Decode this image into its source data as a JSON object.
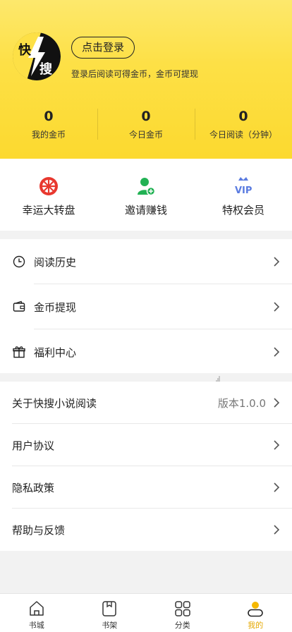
{
  "header": {
    "logo_text": [
      "快",
      "搜"
    ],
    "login_button": "点击登录",
    "login_tip": "登录后阅读可得金币，金币可提现",
    "stats": [
      {
        "value": "0",
        "label": "我的金币"
      },
      {
        "value": "0",
        "label": "今日金币"
      },
      {
        "value": "0",
        "label": "今日阅读（分钟）"
      }
    ]
  },
  "features": [
    {
      "label": "幸运大转盘",
      "icon": "wheel-icon",
      "color": "#e8382f"
    },
    {
      "label": "邀请赚钱",
      "icon": "invite-user-icon",
      "color": "#22b254"
    },
    {
      "label": "特权会员",
      "icon": "vip-crown-icon",
      "color": "#5a7be0"
    }
  ],
  "menu": [
    {
      "label": "阅读历史",
      "icon": "clock-icon"
    },
    {
      "label": "金币提现",
      "icon": "wallet-icon"
    },
    {
      "label": "福利中心",
      "icon": "gift-icon"
    }
  ],
  "settings": [
    {
      "label": "关于快搜小说阅读",
      "value": "版本1.0.0"
    },
    {
      "label": "用户协议"
    },
    {
      "label": "隐私政策"
    },
    {
      "label": "帮助与反馈"
    }
  ],
  "tabs": [
    {
      "label": "书城",
      "icon": "home-icon"
    },
    {
      "label": "书架",
      "icon": "bookshelf-icon"
    },
    {
      "label": "分类",
      "icon": "category-grid-icon"
    },
    {
      "label": "我的",
      "icon": "profile-icon",
      "active": true
    }
  ],
  "colors": {
    "brand_yellow": "#fde046",
    "active_tab": "#e5a800"
  }
}
